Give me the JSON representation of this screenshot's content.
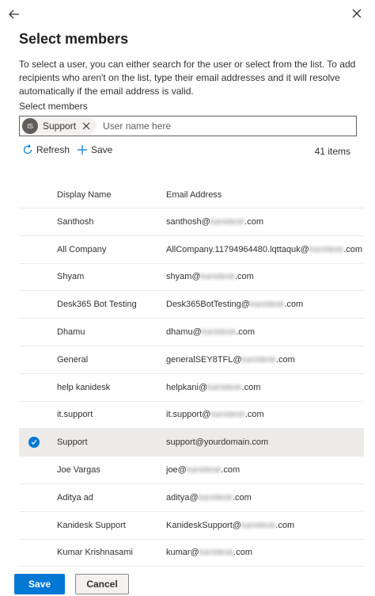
{
  "panel": {
    "title": "Select members",
    "description": "To select a user, you can either search for the user or select from the list. To add recipients who aren't on the list, type their email addresses and it will resolve automatically if the email address is valid."
  },
  "picker": {
    "label": "Select members",
    "chip": {
      "initials": "IS",
      "name": "Support"
    },
    "placeholder": "User name here"
  },
  "commands": {
    "refresh_label": "Refresh",
    "save_label": "Save",
    "item_count": "41 items"
  },
  "table": {
    "columns": [
      "Display Name",
      "Email Address"
    ],
    "rows": [
      {
        "name": "Santhosh",
        "email_prefix": "santhosh@",
        "email_domain": "kanidesk",
        "email_suffix": ".com",
        "selected": false
      },
      {
        "name": "All Company",
        "email_prefix": "AllCompany.11794964480.lqttaquk@",
        "email_domain": "kanidesk",
        "email_suffix": ".com",
        "selected": false
      },
      {
        "name": "Shyam",
        "email_prefix": "shyam@",
        "email_domain": "kanidesk",
        "email_suffix": ".com",
        "selected": false
      },
      {
        "name": "Desk365 Bot Testing",
        "email_prefix": "Desk365BotTesting@",
        "email_domain": "kanidesk",
        "email_suffix": ".com",
        "selected": false
      },
      {
        "name": "Dhamu",
        "email_prefix": "dhamu@",
        "email_domain": "kanidesk",
        "email_suffix": ".com",
        "selected": false
      },
      {
        "name": "General",
        "email_prefix": "generalSEY8TFL@",
        "email_domain": "kanidesk",
        "email_suffix": ".com",
        "selected": false
      },
      {
        "name": "help kanidesk",
        "email_prefix": "helpkani@",
        "email_domain": "kanidesk",
        "email_suffix": ".com",
        "selected": false
      },
      {
        "name": "it.support",
        "email_prefix": "it.support@",
        "email_domain": "kanidesk",
        "email_suffix": ".com",
        "selected": false
      },
      {
        "name": "Support",
        "email_prefix": "support@yourdomain.com",
        "email_domain": "",
        "email_suffix": "",
        "selected": true
      },
      {
        "name": "Joe Vargas",
        "email_prefix": "joe@",
        "email_domain": "kanidesk",
        "email_suffix": ".com",
        "selected": false
      },
      {
        "name": "Aditya ad",
        "email_prefix": "aditya@",
        "email_domain": "kanidesk",
        "email_suffix": ".com",
        "selected": false
      },
      {
        "name": "Kanidesk Support",
        "email_prefix": "KanideskSupport@",
        "email_domain": "kanidesk",
        "email_suffix": ".com",
        "selected": false
      },
      {
        "name": "Kumar Krishnasami",
        "email_prefix": "kumar@",
        "email_domain": "kanidesk",
        "email_suffix": ".com",
        "selected": false
      }
    ]
  },
  "footer": {
    "save_label": "Save",
    "cancel_label": "Cancel"
  },
  "colors": {
    "accent": "#0078d4",
    "selected_row": "#edebe9"
  }
}
